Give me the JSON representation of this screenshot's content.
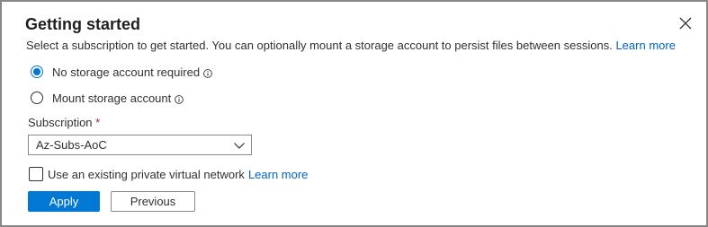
{
  "dialog": {
    "title": "Getting started",
    "description": "Select a subscription to get started. You can optionally mount a storage account to persist files between sessions.",
    "description_link": "Learn more"
  },
  "storage_options": [
    {
      "label": "No storage account required",
      "selected": true
    },
    {
      "label": "Mount storage account",
      "selected": false
    }
  ],
  "subscription": {
    "label": "Subscription",
    "required_marker": "*",
    "value": "Az-Subs-AoC"
  },
  "vnet": {
    "label": "Use an existing private virtual network",
    "link": "Learn more",
    "checked": false
  },
  "buttons": {
    "apply": "Apply",
    "previous": "Previous"
  },
  "colors": {
    "accent": "#0078d4",
    "link": "#0062c4",
    "required": "#a4262c"
  }
}
